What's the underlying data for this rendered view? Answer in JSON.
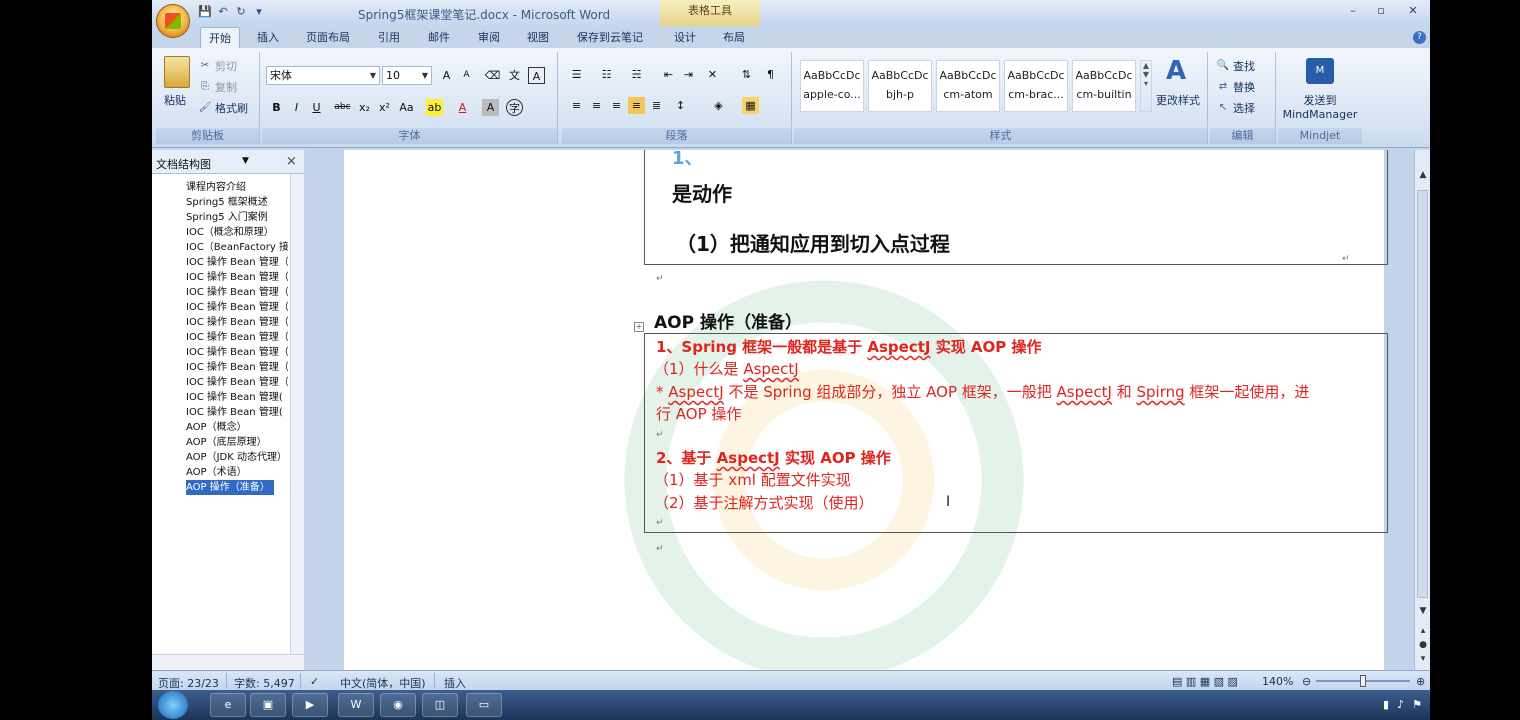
{
  "window": {
    "title": "Spring5框架课堂笔记.docx - Microsoft Word",
    "contextual_tab": "表格工具",
    "controls": [
      "–",
      "▫",
      "✕"
    ]
  },
  "ribbon_tabs": [
    "开始",
    "插入",
    "页面布局",
    "引用",
    "邮件",
    "审阅",
    "视图",
    "保存到云笔记",
    "设计",
    "布局"
  ],
  "clipboard": {
    "paste": "粘贴",
    "cut": "剪切",
    "copy": "复制",
    "format_painter": "格式刷",
    "label": "剪贴板"
  },
  "font": {
    "name": "宋体",
    "size": "10",
    "label": "字体"
  },
  "paragraph": {
    "label": "段落"
  },
  "styles": {
    "label": "样式",
    "sample": "AaBbCcDc",
    "items": [
      "apple-co...",
      "bjh-p",
      "cm-atom",
      "cm-brac...",
      "cm-builtin"
    ],
    "change": "更改样式"
  },
  "editing": {
    "find": "查找",
    "replace": "替换",
    "select": "选择",
    "label": "编辑"
  },
  "mindjet": {
    "send": "发送到",
    "app": "MindManager",
    "label": "Mindjet"
  },
  "docmap": {
    "title": "文档结构图",
    "items": [
      "课程内容介绍",
      "Spring5 框架概述",
      "Spring5 入门案例",
      "IOC（概念和原理）",
      "IOC（BeanFactory 接",
      "IOC 操作 Bean 管理（",
      "IOC 操作 Bean 管理（",
      "IOC 操作 Bean 管理（",
      "IOC 操作 Bean 管理（",
      "IOC 操作 Bean 管理（",
      "IOC 操作 Bean 管理（",
      "IOC 操作 Bean 管理（",
      "IOC 操作 Bean 管理（",
      "IOC 操作 Bean 管理（",
      "IOC 操作 Bean 管理(",
      "IOC 操作 Bean 管理(",
      "AOP（概念）",
      "AOP（底层原理）",
      "AOP（JDK 动态代理）",
      "AOP（术语）",
      "AOP 操作（准备）"
    ],
    "selected_index": 20
  },
  "document": {
    "top_box": {
      "line1": "是动作",
      "line2": "（1）把通知应用到切入点过程"
    },
    "heading": "AOP 操作（准备）",
    "box": {
      "l1_a": "1、Spring 框架一般都是基于 ",
      "l1_b": "AspectJ",
      "l1_c": " 实现 AOP 操作",
      "l2_a": "（1）什么是 ",
      "l2_b": "AspectJ",
      "l3_a": "* ",
      "l3_b": "AspectJ",
      "l3_c": " 不是 Spring 组成部分，独立 AOP 框架，一般把 ",
      "l3_d": "AspectJ",
      "l3_e": " 和 ",
      "l3_f": "Spirng",
      "l3_g": " 框架一起使用，进",
      "l4": "行 AOP 操作",
      "l5_a": "2、基于 ",
      "l5_b": "AspectJ",
      "l5_c": " 实现 AOP 操作",
      "l6": "（1）基于 xml 配置文件实现",
      "l7": "（2）基于注解方式实现（使用）"
    }
  },
  "status": {
    "page": "页面: 23/23",
    "words": "字数: 5,497",
    "language": "中文(简体，中国)",
    "mode": "插入",
    "zoom": "140%",
    "zoom_value": 140
  },
  "colors": {
    "red_text": "#e0241e",
    "ribbon": "#d9e5f4",
    "selection": "#316ac5"
  }
}
